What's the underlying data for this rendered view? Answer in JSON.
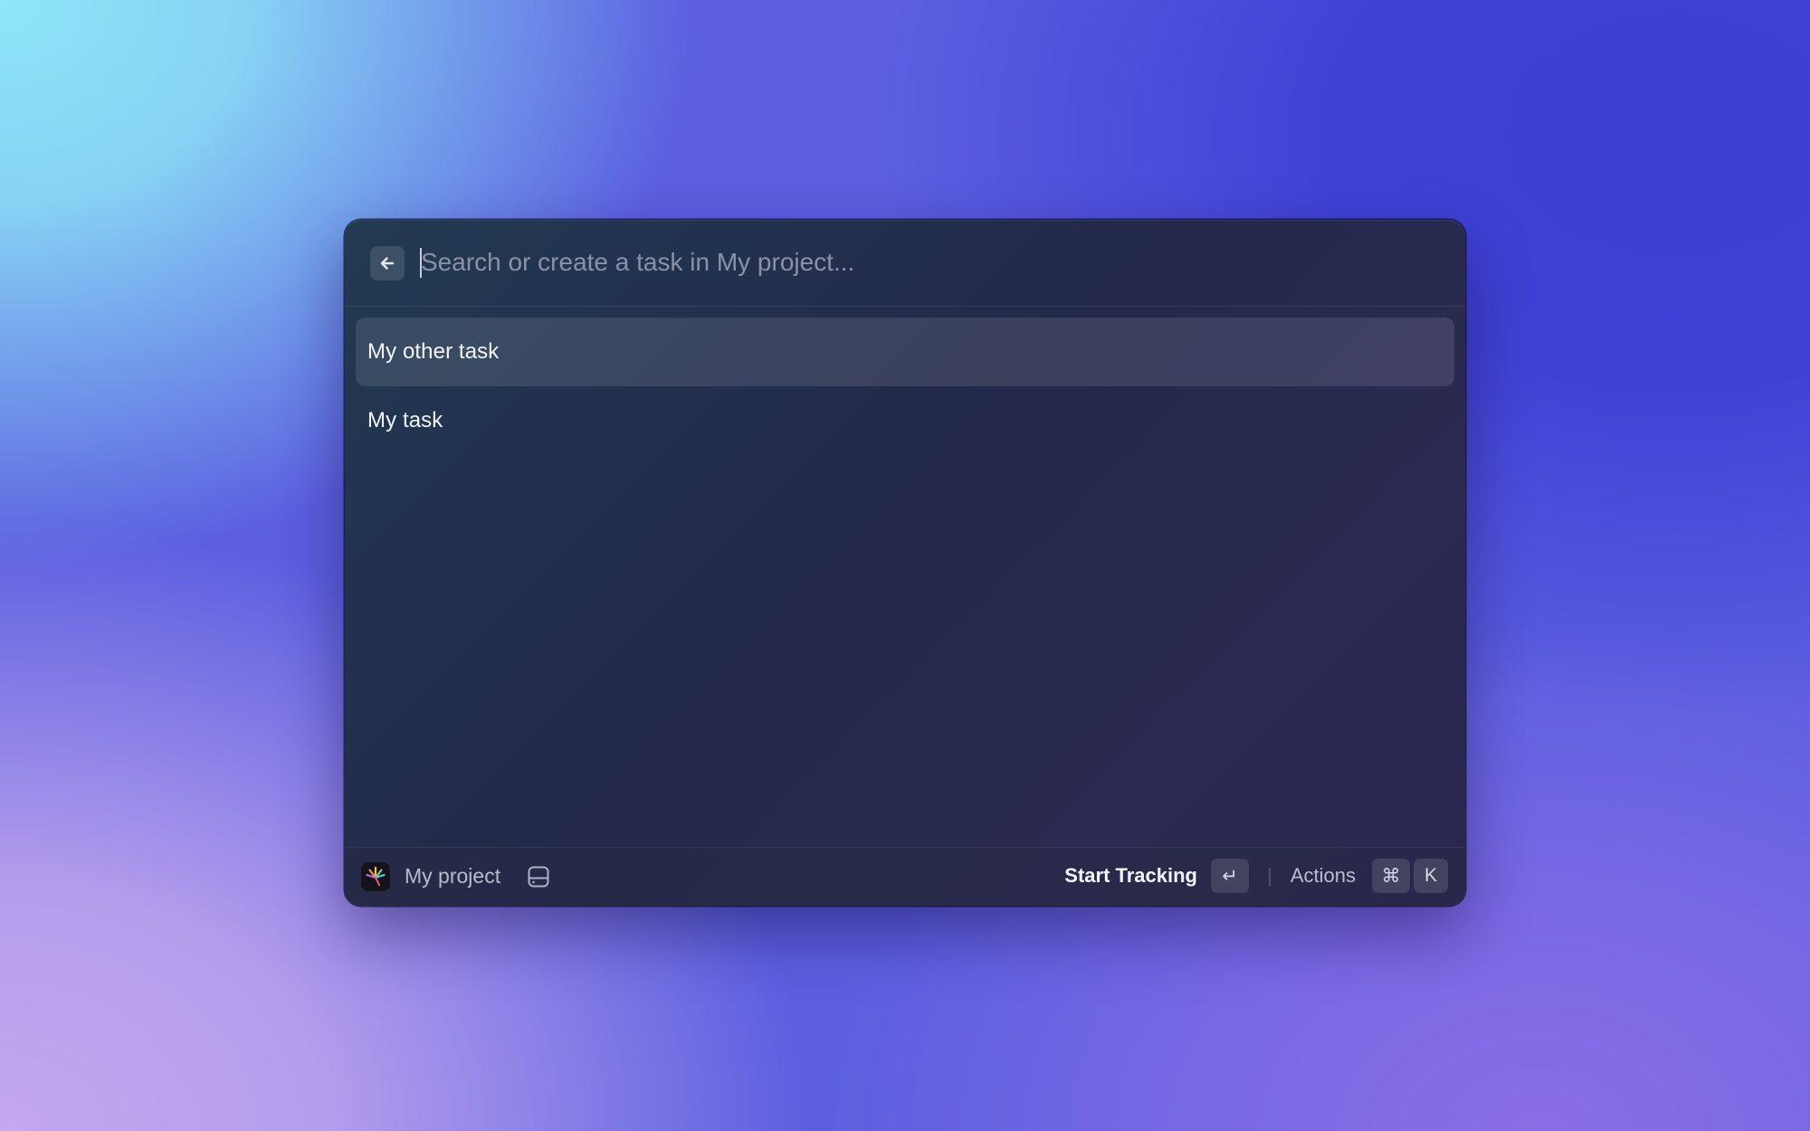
{
  "search": {
    "placeholder": "Search or create a task in My project...",
    "value": ""
  },
  "tasks": [
    {
      "label": "My other task",
      "selected": true
    },
    {
      "label": "My task",
      "selected": false
    }
  ],
  "footer": {
    "project_name": "My project",
    "primary_action": "Start Tracking",
    "enter_key": "↵",
    "actions_label": "Actions",
    "cmd_key": "⌘",
    "k_key": "K"
  },
  "icons": {
    "back": "arrow-left-icon",
    "app": "app-logo-icon",
    "drive": "hard-drive-icon"
  },
  "colors": {
    "window_bg": "#23294a",
    "selected_row": "#3a4560",
    "text_primary": "#f2f4fa",
    "text_secondary": "#b7bccd",
    "placeholder": "#8a92a8"
  }
}
